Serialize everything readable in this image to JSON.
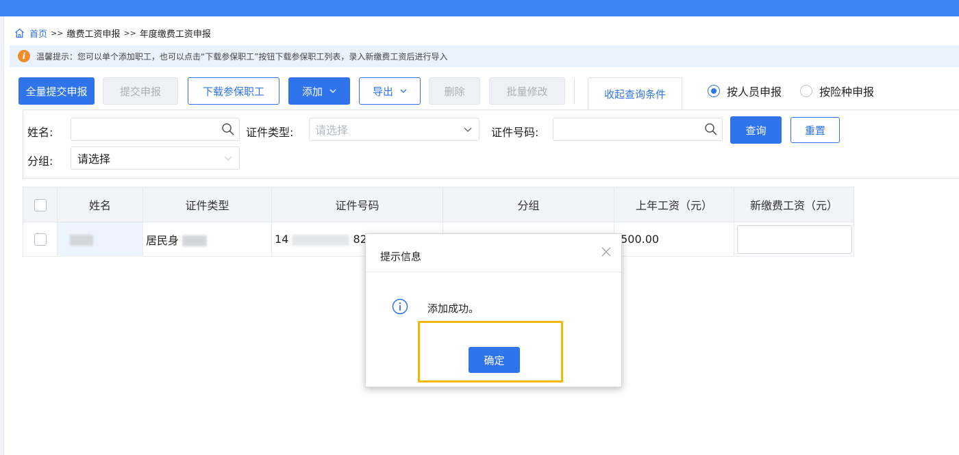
{
  "breadcrumb": {
    "home": "首页",
    "separator": ">>",
    "level1": "缴费工资申报",
    "level2": "年度缴费工资申报"
  },
  "tip": {
    "icon": "info-icon",
    "text": "温馨提示：您可以单个添加职工，也可以点击“下载参保职工”按钮下载参保职工列表，录入新缴费工资后进行导入"
  },
  "toolbar": {
    "submit_all": "全量提交申报",
    "submit": "提交申报",
    "download": "下载参保职工",
    "add": "添加",
    "export": "导出",
    "delete": "删除",
    "batch_edit": "批量修改",
    "collapse": "收起查询条件"
  },
  "mode": {
    "by_person": "按人员申报",
    "by_insurance": "按险种申报",
    "selected": "by_person"
  },
  "filters": {
    "name_label": "姓名:",
    "name_value": "",
    "id_type_label": "证件类型:",
    "id_type_placeholder": "请选择",
    "id_no_label": "证件号码:",
    "id_no_value": "",
    "group_label": "分组:",
    "group_value": "请选择",
    "query": "查询",
    "reset": "重置"
  },
  "table": {
    "columns": [
      "姓名",
      "证件类型",
      "证件号码",
      "分组",
      "上年工资（元）",
      "新缴费工资（元）"
    ],
    "rows": [
      {
        "name": "",
        "id_type": "居民身",
        "id_no_prefix": "14",
        "id_no_suffix": "82",
        "group": "",
        "last_year_wage": ",500.00",
        "new_wage": ""
      }
    ]
  },
  "dialog": {
    "title": "提示信息",
    "message": "添加成功。",
    "ok": "确定",
    "icon": "info-circle-icon"
  },
  "colors": {
    "primary": "#2f74ea",
    "topbar": "#3d86f2",
    "highlight": "#f5b800",
    "tip_bg": "#eaf2fd",
    "tip_icon": "#f08c2a"
  }
}
